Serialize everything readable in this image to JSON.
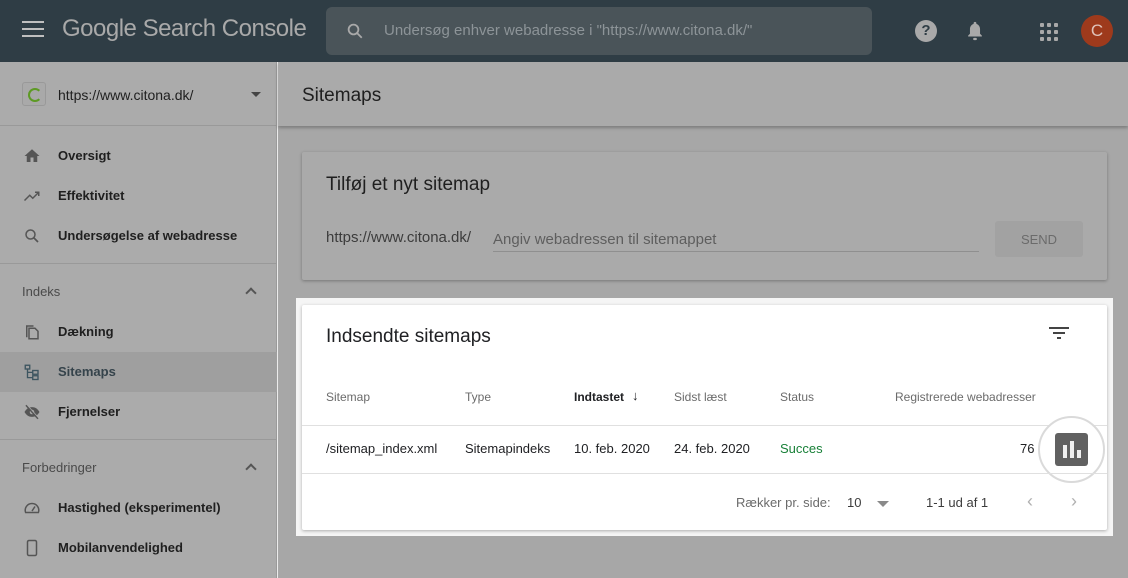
{
  "topbar": {
    "logo_google": "Google",
    "logo_product": "Search Console",
    "search_placeholder": "Undersøg enhver webadresse i \"https://www.citona.dk/\"",
    "avatar_letter": "C",
    "help_glyph": "?"
  },
  "sidebar": {
    "property_url": "https://www.citona.dk/",
    "top_items": [
      {
        "label": "Oversigt",
        "icon": "home-icon"
      },
      {
        "label": "Effektivitet",
        "icon": "trending-up-icon"
      },
      {
        "label": "Undersøgelse af webadresse",
        "icon": "search-icon"
      }
    ],
    "sections": [
      {
        "title": "Indeks",
        "items": [
          {
            "label": "Dækning",
            "icon": "copy-pages-icon"
          },
          {
            "label": "Sitemaps",
            "icon": "sitemap-icon",
            "active": true
          },
          {
            "label": "Fjernelser",
            "icon": "visibility-off-icon"
          }
        ]
      },
      {
        "title": "Forbedringer",
        "items": [
          {
            "label": "Hastighed (eksperimentel)",
            "icon": "speed-gauge-icon"
          },
          {
            "label": "Mobilanvendelighed",
            "icon": "smartphone-icon"
          }
        ]
      }
    ]
  },
  "main": {
    "page_title": "Sitemaps",
    "add_card": {
      "title": "Tilføj et nyt sitemap",
      "prefix": "https://www.citona.dk/",
      "input_placeholder": "Angiv webadressen til sitemappet",
      "input_value": "",
      "send_label": "SEND"
    },
    "submitted": {
      "title": "Indsendte sitemaps",
      "columns": [
        "Sitemap",
        "Type",
        "Indtastet",
        "Sidst læst",
        "Status",
        "Registrerede webadresser"
      ],
      "sorted_column": "Indtastet",
      "sort_direction": "descending",
      "rows": [
        {
          "sitemap": "/sitemap_index.xml",
          "type": "Sitemapindeks",
          "submitted": "10. feb. 2020",
          "last_read": "24. feb. 2020",
          "status": "Succes",
          "discovered_urls": "76"
        }
      ],
      "pager": {
        "rows_per_page_label": "Rækker pr. side:",
        "rows_per_page": "10",
        "range": "1-1 ud af 1",
        "prev_glyph": "‹",
        "next_glyph": "›"
      }
    }
  },
  "colors": {
    "topbar_bg": "#2f3d45",
    "avatar_bg": "#9e3a1c",
    "status_success": "#188038",
    "overlay_dim": "#ababab"
  }
}
